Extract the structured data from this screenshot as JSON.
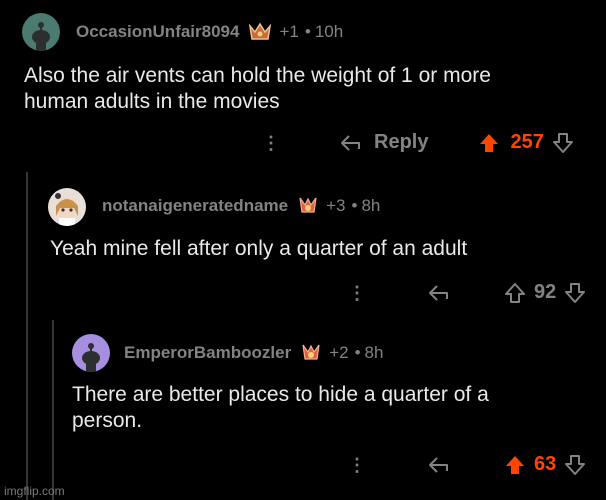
{
  "comments": [
    {
      "username": "OccasionUnfair8094",
      "karma_change": "+1",
      "separator": "•",
      "time": "10h",
      "body_lines": [
        "Also the air vents can hold the weight of 1 or more",
        "human adults in the movies"
      ],
      "reply_label": "Reply",
      "score": "257",
      "upvoted": true,
      "colors": {
        "avatar": "#4a7a70",
        "score": "#ff4500"
      }
    },
    {
      "username": "notanaigeneratedname",
      "karma_change": "+3",
      "separator": "•",
      "time": "8h",
      "body_lines": [
        "Yeah mine fell after only a quarter of an adult"
      ],
      "reply_label": "",
      "score": "92",
      "upvoted": false,
      "colors": {
        "avatar": "#e8e0d8",
        "score": "#818384"
      }
    },
    {
      "username": "EmperorBamboozler",
      "karma_change": "+2",
      "separator": "•",
      "time": "8h",
      "body_lines": [
        "There are better places to hide a quarter of a",
        "person."
      ],
      "reply_label": "",
      "score": "63",
      "upvoted": true,
      "colors": {
        "avatar": "#a68fe0",
        "score": "#ff4500"
      }
    }
  ],
  "watermark": "imgflip.com",
  "icons": [
    "snoo-avatar-icon",
    "award-icon",
    "more-options-icon",
    "reply-arrow-icon",
    "upvote-arrow-icon",
    "downvote-arrow-icon"
  ]
}
